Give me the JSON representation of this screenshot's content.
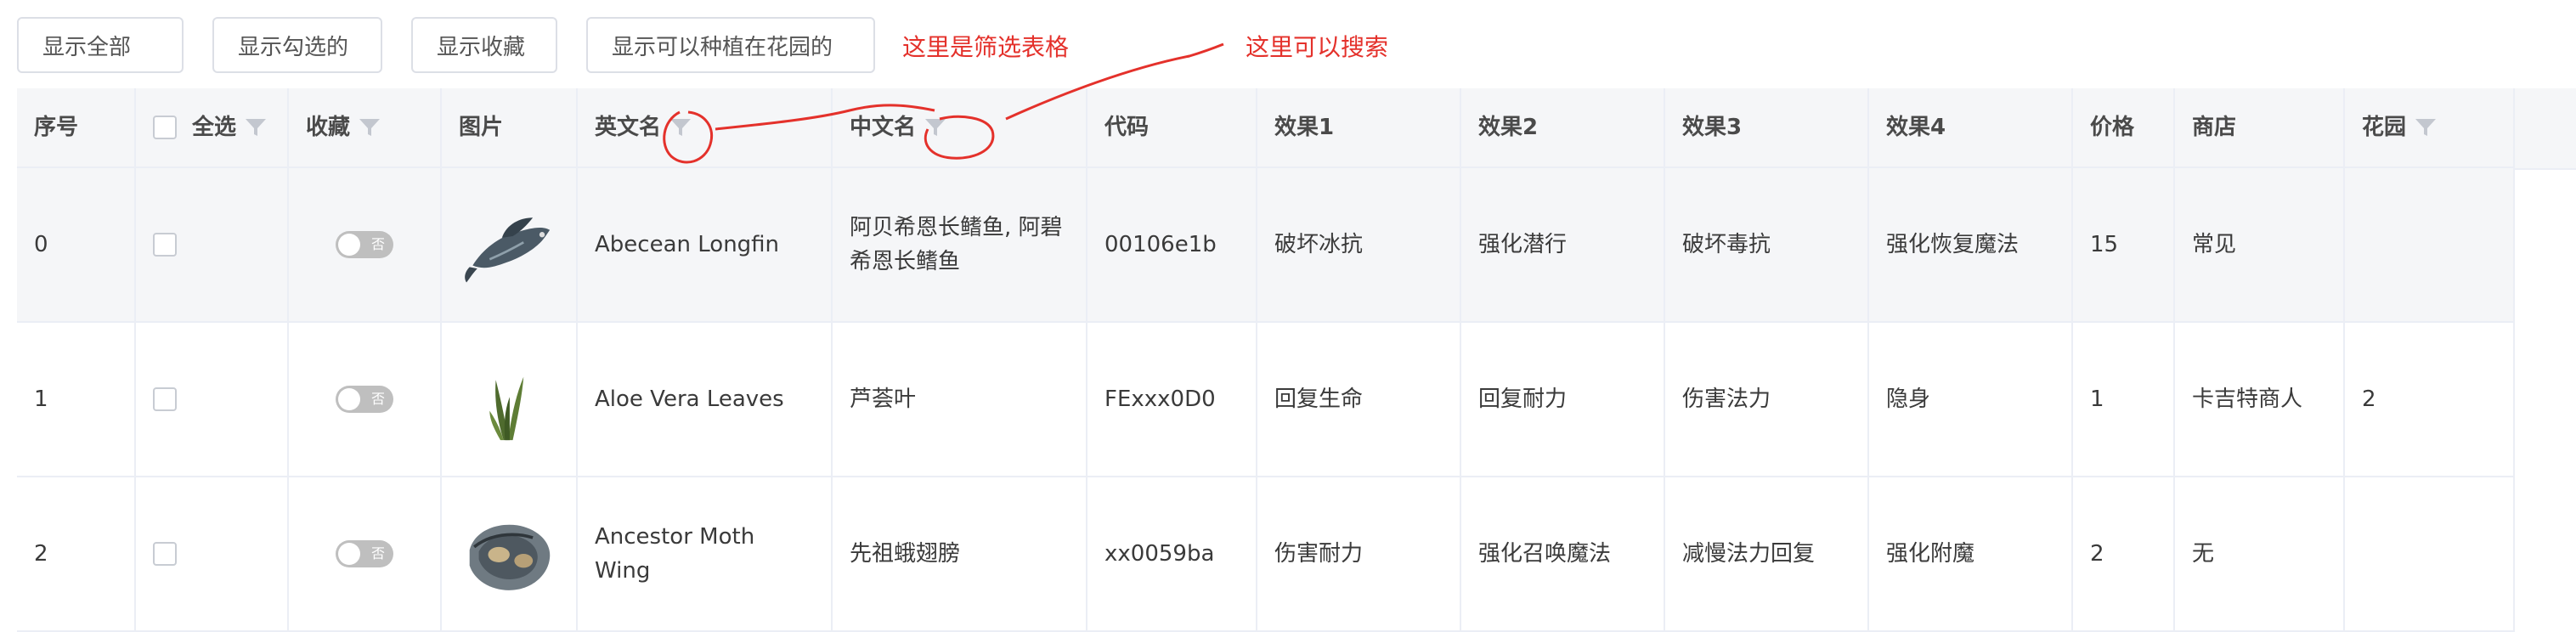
{
  "toolbar": {
    "buttons": [
      "显示全部",
      "显示勾选的",
      "显示收藏",
      "显示可以种植在花园的"
    ]
  },
  "annotations": {
    "filter_note": "这里是筛选表格",
    "search_note": "这里可以搜索"
  },
  "colors": {
    "annotation": "#e4312b",
    "header_bg": "#f5f6f8",
    "border": "#ebeef5",
    "switch_off": "#bfbfbf"
  },
  "table": {
    "headers": {
      "index": "序号",
      "select_all": "全选",
      "favorite": "收藏",
      "image": "图片",
      "english_name": "英文名",
      "chinese_name": "中文名",
      "code": "代码",
      "effect1": "效果1",
      "effect2": "效果2",
      "effect3": "效果3",
      "effect4": "效果4",
      "price": "价格",
      "shop": "商店",
      "garden": "花园"
    },
    "rows": [
      {
        "index": "0",
        "favorite": "否",
        "image_icon": "fish-image",
        "english_name": "Abecean Longfin",
        "chinese_name": "阿贝希恩长鳍鱼, 阿碧希恩长鳍鱼",
        "code": "00106e1b",
        "effect1": "破坏冰抗",
        "effect2": "强化潜行",
        "effect3": "破坏毒抗",
        "effect4": "强化恢复魔法",
        "price": "15",
        "shop": "常见",
        "garden": ""
      },
      {
        "index": "1",
        "favorite": "否",
        "image_icon": "aloe-leaves-image",
        "english_name": "Aloe Vera Leaves",
        "chinese_name": "芦荟叶",
        "code": "FExxx0D0",
        "effect1": "回复生命",
        "effect2": "回复耐力",
        "effect3": "伤害法力",
        "effect4": "隐身",
        "price": "1",
        "shop": "卡吉特商人",
        "garden": "2"
      },
      {
        "index": "2",
        "favorite": "否",
        "image_icon": "moth-wing-image",
        "english_name": "Ancestor Moth Wing",
        "chinese_name": "先祖蛾翅膀",
        "code": "xx0059ba",
        "effect1": "伤害耐力",
        "effect2": "强化召唤魔法",
        "effect3": "减慢法力回复",
        "effect4": "强化附魔",
        "price": "2",
        "shop": "无",
        "garden": ""
      }
    ]
  }
}
